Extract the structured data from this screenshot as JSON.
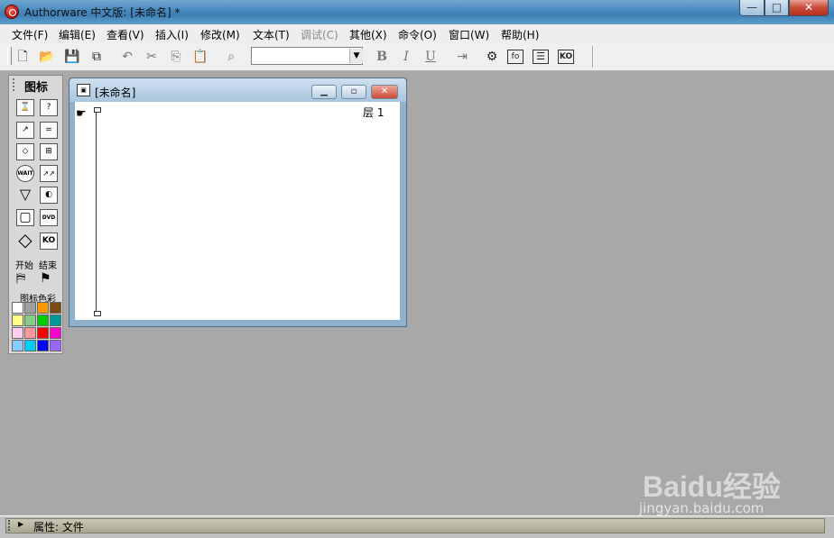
{
  "window": {
    "title": "Authorware 中文版: [未命名] *",
    "min": "—",
    "max": "□",
    "close": "✕"
  },
  "menu": [
    "文件(F)",
    "编辑(E)",
    "查看(V)",
    "插入(I)",
    "修改(M)",
    "文本(T)",
    "调试(C)",
    "其他(X)",
    "命令(O)",
    "窗口(W)",
    "帮助(H)"
  ],
  "menu_disabled": "调试(C)",
  "toolbar": {
    "icons": [
      "new-file-icon",
      "open-file-icon",
      "save-all-icon",
      "import-icon",
      "undo-icon",
      "cut-icon",
      "copy-icon",
      "paste-icon",
      "find-icon",
      "bold-icon",
      "italic-icon",
      "underline-icon",
      "run-icon",
      "control-panel-icon",
      "functions-icon",
      "variables-icon",
      "knowledge-objects-icon"
    ],
    "font_combo_value": "",
    "bold": "B",
    "italic": "I",
    "underline": "U"
  },
  "palette": {
    "title": "图标",
    "icons": [
      {
        "name": "display-icon",
        "glyph": "⌛"
      },
      {
        "name": "interaction-icon",
        "glyph": "?"
      },
      {
        "name": "motion-icon",
        "glyph": "↗"
      },
      {
        "name": "calculation-icon",
        "glyph": "="
      },
      {
        "name": "erase-icon",
        "glyph": "◇"
      },
      {
        "name": "map-icon",
        "glyph": "⊞"
      },
      {
        "name": "wait-icon",
        "glyph": "WAIT"
      },
      {
        "name": "navigate-icon",
        "glyph": "↗↗"
      },
      {
        "name": "framework-icon",
        "glyph": "▽"
      },
      {
        "name": "sound-icon",
        "glyph": "◐"
      },
      {
        "name": "decision-icon",
        "glyph": "▢"
      },
      {
        "name": "digital-movie-icon",
        "glyph": "DVD"
      },
      {
        "name": "diamond-icon",
        "glyph": "◇"
      },
      {
        "name": "knowledge-object-icon",
        "glyph": "KO"
      }
    ],
    "start_label": "开始",
    "end_label": "结束",
    "colors_label": "图标色彩",
    "colors": [
      "#ffffff",
      "#a0a0a0",
      "#ff9900",
      "#7a4a10",
      "#ffff88",
      "#88cc88",
      "#00cc00",
      "#009999",
      "#ffccee",
      "#ff9999",
      "#ff0000",
      "#ff00cc",
      "#88ccff",
      "#00ccff",
      "#0000ff",
      "#9966ff"
    ]
  },
  "flowline_window": {
    "title": "[未命名]",
    "layer": "层 1"
  },
  "status": {
    "text": "属性: 文件"
  },
  "watermark": {
    "logo": "Baidu经验",
    "url": "jingyan.baidu.com"
  }
}
